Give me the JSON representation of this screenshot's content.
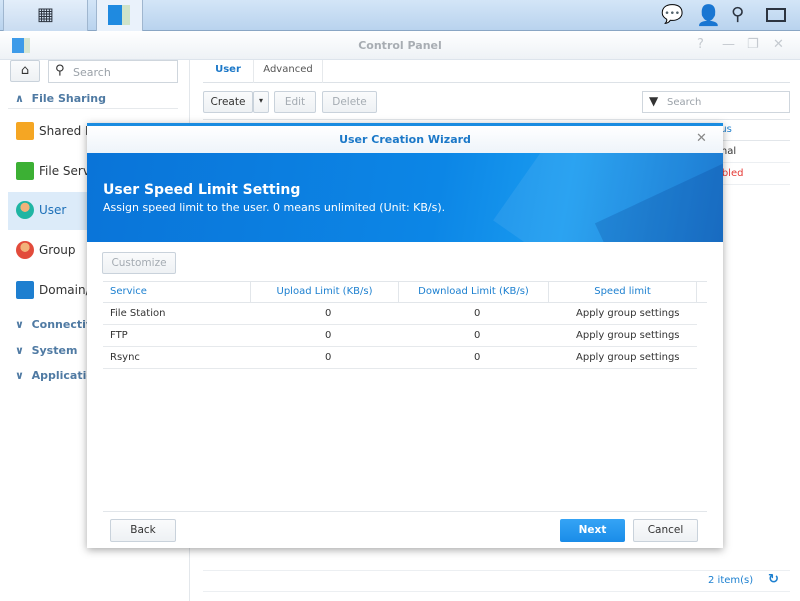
{
  "taskbar": {
    "icons": [
      "main-menu-icon",
      "control-panel-app-icon",
      "chat-icon",
      "user-icon",
      "search-icon",
      "widgets-icon"
    ]
  },
  "window": {
    "title": "Control Panel"
  },
  "sidebar": {
    "search_placeholder": "Search",
    "sections": [
      {
        "label": "File Sharing",
        "expanded": true
      },
      {
        "label": "Connectivity"
      },
      {
        "label": "System"
      },
      {
        "label": "Applications"
      }
    ],
    "items": [
      {
        "label": "Shared Folder",
        "color": "#f5a623"
      },
      {
        "label": "File Services",
        "color": "#3cb034"
      },
      {
        "label": "User",
        "selected": true
      },
      {
        "label": "Group"
      },
      {
        "label": "Domain/LDAP",
        "color": "#1e7fd0"
      }
    ]
  },
  "main": {
    "tabs": [
      {
        "label": "User",
        "active": true
      },
      {
        "label": "Advanced"
      }
    ],
    "toolbar": {
      "create": "Create",
      "edit": "Edit",
      "delete": "Delete",
      "search_placeholder": "Search"
    },
    "table": {
      "status_header": "Status",
      "rows": [
        {
          "status": "Normal"
        },
        {
          "status": "Disabled",
          "color": "#e53935"
        }
      ]
    },
    "footer": {
      "count": "2 item(s)"
    }
  },
  "dialog": {
    "title": "User Creation Wizard",
    "heading": "User Speed Limit Setting",
    "subheading": "Assign speed limit to the user. 0 means unlimited (Unit: KB/s).",
    "customize": "Customize",
    "columns": [
      "Service",
      "Upload Limit (KB/s)",
      "Download Limit (KB/s)",
      "Speed limit"
    ],
    "rows": [
      {
        "service": "File Station",
        "upload": "0",
        "download": "0",
        "limit": "Apply group settings"
      },
      {
        "service": "FTP",
        "upload": "0",
        "download": "0",
        "limit": "Apply group settings"
      },
      {
        "service": "Rsync",
        "upload": "0",
        "download": "0",
        "limit": "Apply group settings"
      }
    ],
    "back": "Back",
    "next": "Next",
    "cancel": "Cancel"
  },
  "colors": {
    "accent": "#1a8ce0",
    "next_button": "#2196f3"
  }
}
